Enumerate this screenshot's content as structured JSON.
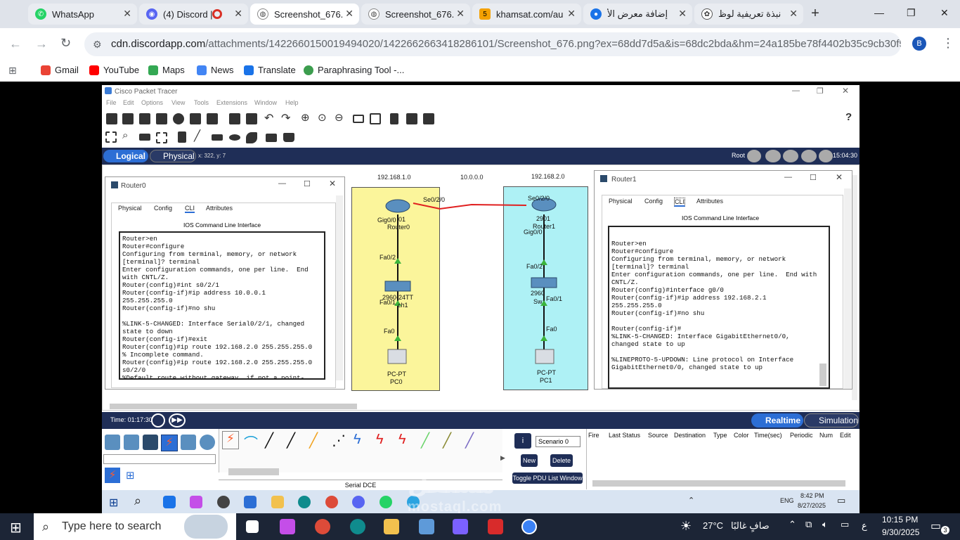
{
  "browser": {
    "tabs": [
      {
        "label": "WhatsApp",
        "color": "#25d366"
      },
      {
        "label": "(4) Discord |",
        "color": "#5865f2"
      },
      {
        "label": "Screenshot_676.",
        "color": "#888888",
        "active": true
      },
      {
        "label": "Screenshot_676.",
        "color": "#888888"
      },
      {
        "label": "khamsat.com/au",
        "color": "#f4a100"
      },
      {
        "label": "إضافة معرض الأ",
        "color": "#1a73e8"
      },
      {
        "label": "نبذة تعريفية لوظ",
        "color": "#444444"
      }
    ],
    "new_tab": "+",
    "url_host": "cdn.discordapp.com",
    "url_path": "/attachments/1422660150019494020/1422662663418286101/Screenshot_676.png?ex=68dd7d5a&is=68dc2bda&hm=24a185be78f4402b35c9cb30f5b9b...",
    "profile_initial": "B",
    "bookmarks": [
      "Gmail",
      "YouTube",
      "Maps",
      "News",
      "Translate",
      "Paraphrasing Tool -..."
    ]
  },
  "pt": {
    "title": "Cisco Packet Tracer",
    "menu": [
      "File",
      "Edit",
      "Options",
      "View",
      "Tools",
      "Extensions",
      "Window",
      "Help"
    ],
    "logical": "Logical",
    "physical": "Physical",
    "coords": "x: 322, y: 7",
    "root": "Root",
    "clock": "15:04:30",
    "networks": [
      "192.168.1.0",
      "10.0.0.0",
      "192.168.2.0"
    ],
    "devices": {
      "router0_port_top": "Se0/2/0",
      "router0_gig": "Gig0/0",
      "router0_model": "01",
      "router0_name": "Router0",
      "switch0_fa2": "Fa0/2",
      "switch0_model": "2960-24TT",
      "switch0_name": "ch1",
      "switch0_fa1": "Fa0/1",
      "pc0_fa": "Fa0",
      "pc0_type": "PC-PT",
      "pc0_name": "PC0",
      "router1_port": "Se0/2/0",
      "router1_model": "2901",
      "router1_name": "Router1",
      "router1_gig": "Gig0/0",
      "switch1_fa2": "Fa0/2",
      "switch1_model": "2960",
      "switch1_name": "Sw",
      "switch1_fa1": "Fa0/1",
      "pc1_fa": "Fa0",
      "pc1_type": "PC-PT",
      "pc1_name": "PC1"
    },
    "router0_window": {
      "title": "Router0",
      "tabs": [
        "Physical",
        "Config",
        "CLI",
        "Attributes"
      ],
      "heading": "IOS Command Line Interface",
      "text": "Router>en\nRouter#configure\nConfiguring from terminal, memory, or network\n[terminal]? terminal\nEnter configuration commands, one per line.  End\nwith CNTL/Z.\nRouter(config)#int s0/2/1\nRouter(config-if)#ip address 10.0.0.1\n255.255.255.0\nRouter(config-if)#no shu\n\n%LINK-5-CHANGED: Interface Serial0/2/1, changed\nstate to down\nRouter(config-if)#exit\nRouter(config)#ip route 192.168.2.0 255.255.255.0\n% Incomplete command.\nRouter(config)#ip route 192.168.2.0 255.255.255.0\ns0/2/0\n%Default route without gateway, if not a point-"
    },
    "router1_window": {
      "title": "Router1",
      "tabs": [
        "Physical",
        "Config",
        "CLI",
        "Attributes"
      ],
      "heading": "IOS Command Line Interface",
      "text": "Router>en\nRouter#configure\nConfiguring from terminal, memory, or network\n[terminal]? terminal\nEnter configuration commands, one per line.  End with\nCNTL/Z.\nRouter(config)#interface g0/0\nRouter(config-if)#ip address 192.168.2.1\n255.255.255.0\nRouter(config-if)#no shu\n\nRouter(config-if)#\n%LINK-5-CHANGED: Interface GigabitEthernet0/0,\nchanged state to up\n\n%LINEPROTO-5-UPDOWN: Line protocol on Interface\nGigabitEthernet0/0, changed state to up"
    },
    "time": "Time: 01:17:30",
    "realtime": "Realtime",
    "simulation": "Simulation",
    "connection_type": "Serial DCE",
    "scenario": "Scenario 0",
    "new_btn": "New",
    "delete_btn": "Delete",
    "toggle_pdu": "Toggle PDU List Window",
    "pdu_headers": [
      "Fire",
      "Last Status",
      "Source",
      "Destination",
      "Type",
      "Color",
      "Time(sec)",
      "Periodic",
      "Num",
      "Edit"
    ]
  },
  "inner_taskbar": {
    "lang": "ENG",
    "time": "8:42 PM",
    "date": "8/27/2025"
  },
  "watermark": "مستقل",
  "watermark_sub": "mostaql.com",
  "taskbar": {
    "search_placeholder": "Type here to search",
    "temp": "27°C",
    "weather": "صافٍ غالبًا",
    "lang": "ع",
    "time": "10:15 PM",
    "date": "9/30/2025",
    "notif_count": "3"
  }
}
